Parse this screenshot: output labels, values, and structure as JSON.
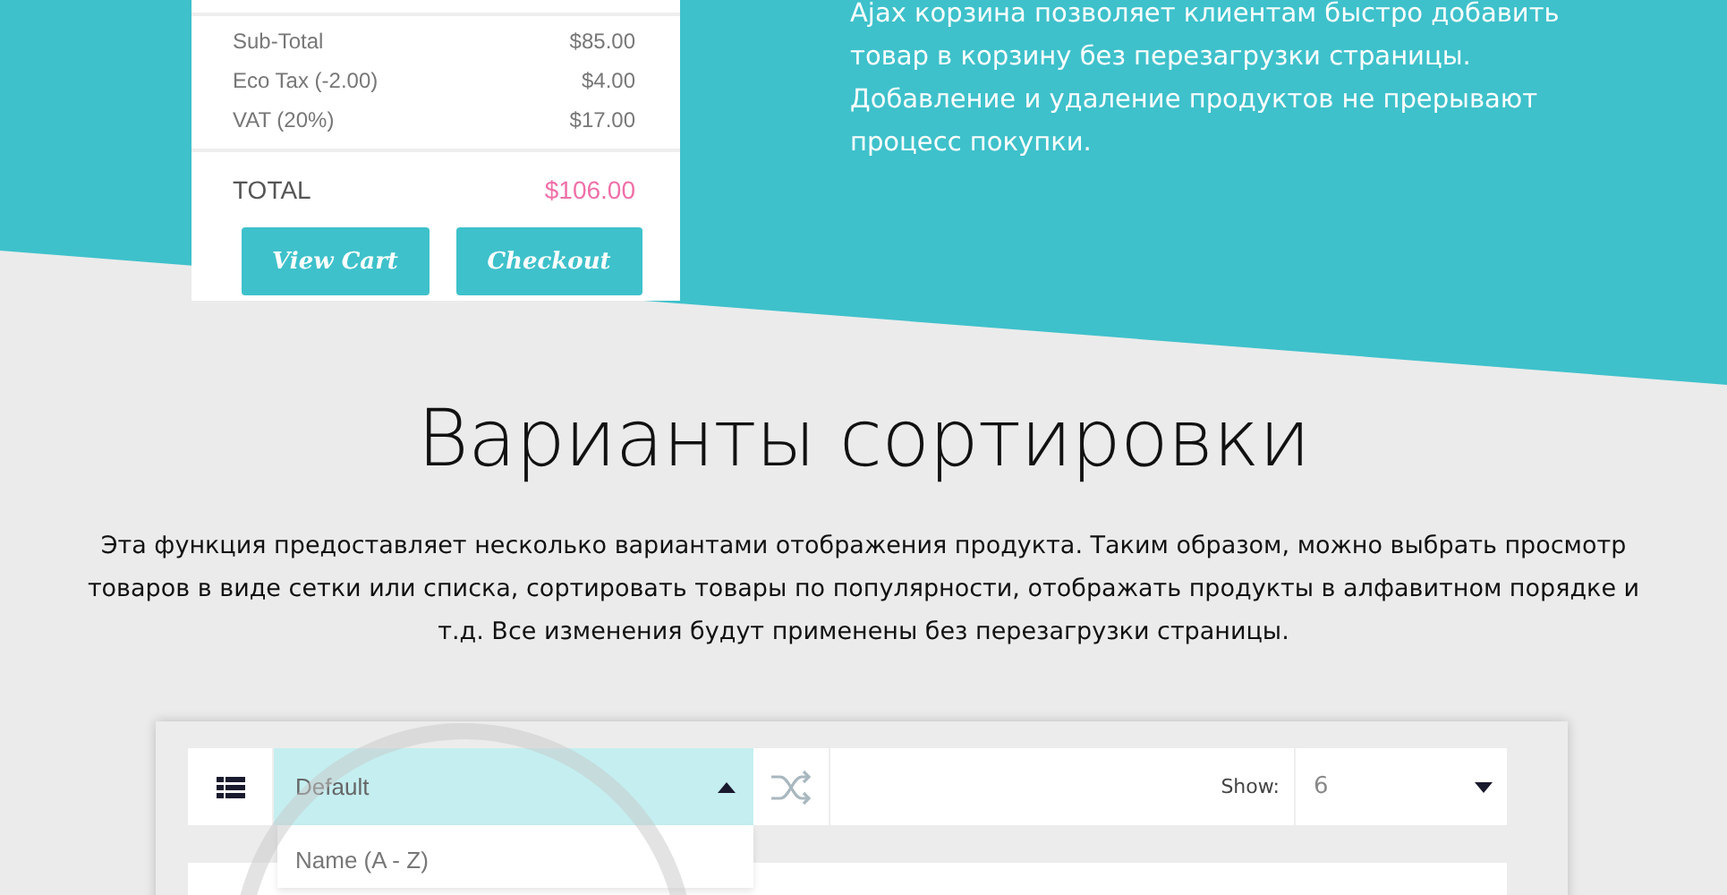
{
  "cart": {
    "rows": [
      {
        "label": "Sub-Total",
        "amount": "$85.00"
      },
      {
        "label": "Eco Tax (-2.00)",
        "amount": "$4.00"
      },
      {
        "label": "VAT (20%)",
        "amount": "$17.00"
      }
    ],
    "total": {
      "label": "TOTAL",
      "amount": "$106.00"
    },
    "buttons": [
      "View Cart",
      "Checkout"
    ]
  },
  "ajax_description": "Ajax корзина позволяет клиентам быстро добавить товар в корзину без перезагрузки страницы. Добавление и удаление продуктов не прерывают процесс покупки.",
  "section": {
    "title": "Варианты сортировки",
    "text": "Эта функция предоставляет несколько вариантами отображения продукта. Таким образом, можно выбрать просмотр товаров в виде сетки или списка, сортировать товары по популярности, отображать продукты в алфавитном порядке и т.д. Все изменения будут применены без перезагрузки страницы."
  },
  "toolbar": {
    "sort": {
      "value": "Default",
      "expanded": true,
      "options": [
        {
          "label": "Name (A - Z)"
        }
      ]
    },
    "show": {
      "label": "Show:",
      "value": "6"
    }
  }
}
